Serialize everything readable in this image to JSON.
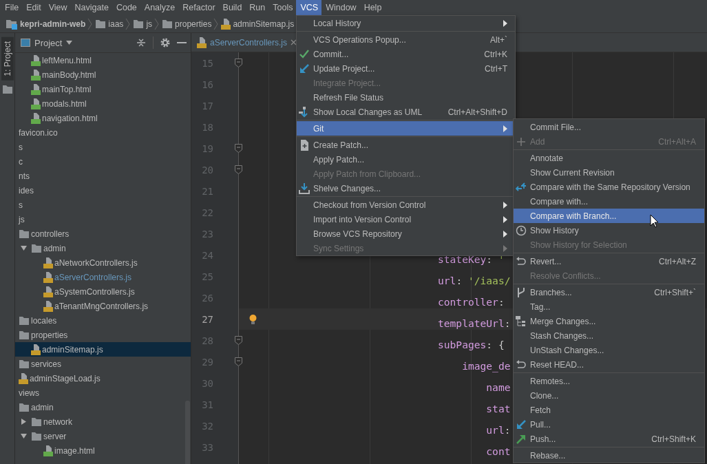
{
  "menu_bar": [
    {
      "label": "File",
      "selected": false
    },
    {
      "label": "Edit",
      "selected": false
    },
    {
      "label": "View",
      "selected": false
    },
    {
      "label": "Navigate",
      "selected": false
    },
    {
      "label": "Code",
      "selected": false
    },
    {
      "label": "Analyze",
      "selected": false
    },
    {
      "label": "Refactor",
      "selected": false
    },
    {
      "label": "Build",
      "selected": false
    },
    {
      "label": "Run",
      "selected": false
    },
    {
      "label": "Tools",
      "selected": false
    },
    {
      "label": "VCS",
      "selected": true
    },
    {
      "label": "Window",
      "selected": false
    },
    {
      "label": "Help",
      "selected": false
    }
  ],
  "breadcrumbs": [
    {
      "label": "kepri-admin-web",
      "kind": "module"
    },
    {
      "label": "iaas",
      "kind": "folder"
    },
    {
      "label": "js",
      "kind": "folder"
    },
    {
      "label": "properties",
      "kind": "folder"
    },
    {
      "label": "adminSitemap.js",
      "kind": "js"
    }
  ],
  "tool_strip": {
    "label": "1: Project",
    "selected": true
  },
  "project_panel": {
    "title": "Project",
    "tree": [
      {
        "children": [
          {
            "children": [
              {
                "label": "leftMenu.html",
                "kind": "html",
                "selected": false,
                "modified": false
              },
              {
                "label": "mainBody.html",
                "kind": "html",
                "selected": false,
                "modified": false
              },
              {
                "label": "mainTop.html",
                "kind": "html",
                "selected": false,
                "modified": false
              },
              {
                "label": "modals.html",
                "kind": "html",
                "selected": false,
                "modified": false
              },
              {
                "label": "navigation.html",
                "kind": "html",
                "selected": false,
                "modified": false
              }
            ]
          }
        ]
      },
      {
        "label": "favicon.ico",
        "kind": "text",
        "selected": false,
        "modified": false
      },
      {
        "label": "s",
        "kind": "text",
        "selected": false,
        "modified": false
      },
      {
        "label": "c",
        "kind": "text",
        "selected": false,
        "modified": false
      },
      {
        "label": "nts",
        "kind": "text",
        "selected": false,
        "modified": false
      },
      {
        "label": "ides",
        "kind": "text",
        "selected": false,
        "modified": false
      },
      {
        "label": "s",
        "kind": "text",
        "selected": false,
        "modified": false
      },
      {
        "label": "js",
        "kind": "text",
        "selected": false,
        "modified": false,
        "children": [
          {
            "label": "controllers",
            "kind": "folder",
            "selected": false,
            "modified": false,
            "children": [
              {
                "label": "admin",
                "kind": "folder",
                "selected": false,
                "modified": false,
                "expanded": true,
                "children": [
                  {
                    "label": "aNetworkControllers.js",
                    "kind": "js",
                    "selected": false,
                    "modified": false
                  },
                  {
                    "label": "aServerControllers.js",
                    "kind": "js",
                    "selected": false,
                    "modified": true
                  },
                  {
                    "label": "aSystemControllers.js",
                    "kind": "js",
                    "selected": false,
                    "modified": false
                  },
                  {
                    "label": "aTenantMngControllers.js",
                    "kind": "js",
                    "selected": false,
                    "modified": false
                  }
                ]
              }
            ]
          },
          {
            "label": "locales",
            "kind": "folder",
            "selected": false,
            "modified": false
          },
          {
            "label": "properties",
            "kind": "folder",
            "selected": false,
            "modified": false,
            "children": [
              {
                "label": "adminSitemap.js",
                "kind": "js",
                "selected": true,
                "modified": false
              }
            ]
          },
          {
            "label": "services",
            "kind": "folder",
            "selected": false,
            "modified": false
          },
          {
            "label": "adminStageLoad.js",
            "kind": "js",
            "selected": false,
            "modified": false
          }
        ]
      },
      {
        "label": "views",
        "kind": "text",
        "selected": false,
        "modified": false,
        "children": [
          {
            "label": "admin",
            "kind": "folder",
            "selected": false,
            "modified": false,
            "children": [
              {
                "label": "network",
                "kind": "folder",
                "selected": false,
                "modified": false,
                "expanded": false
              },
              {
                "label": "server",
                "kind": "folder",
                "selected": false,
                "modified": false,
                "expanded": true,
                "children": [
                  {
                    "label": "image.html",
                    "kind": "html",
                    "selected": false,
                    "modified": false
                  }
                ]
              }
            ]
          }
        ]
      }
    ]
  },
  "editor": {
    "tab": {
      "label": "aServerControllers.js",
      "selected": true
    },
    "lines": [
      {
        "number": "15",
        "fold": true,
        "current": false
      },
      {
        "number": "16",
        "fold": false,
        "current": false
      },
      {
        "number": "17",
        "fold": false,
        "current": false
      },
      {
        "number": "18",
        "fold": false,
        "current": false
      },
      {
        "number": "19",
        "fold": true,
        "current": false
      },
      {
        "number": "20",
        "fold": true,
        "current": false
      },
      {
        "number": "21",
        "fold": false,
        "current": false
      },
      {
        "number": "22",
        "fold": false,
        "current": false
      },
      {
        "number": "23",
        "fold": false,
        "current": false
      },
      {
        "number": "24",
        "fold": false,
        "current": false,
        "tokens": [
          {
            "text": "                            stateKey",
            "kind": "key"
          },
          {
            "text": ": ",
            "kind": "punct"
          },
          {
            "text": "'",
            "kind": "string"
          }
        ]
      },
      {
        "number": "25",
        "fold": false,
        "current": false,
        "tokens": [
          {
            "text": "                            url",
            "kind": "key"
          },
          {
            "text": ": ",
            "kind": "punct"
          },
          {
            "text": "'/iaas/",
            "kind": "string"
          }
        ]
      },
      {
        "number": "26",
        "fold": false,
        "current": false,
        "tokens": [
          {
            "text": "                            controller",
            "kind": "key"
          },
          {
            "text": ":",
            "kind": "punct"
          }
        ]
      },
      {
        "number": "27",
        "fold": false,
        "current": true,
        "tokens": [
          {
            "text": "                            templateUrl",
            "kind": "key"
          },
          {
            "text": ":",
            "kind": "punct"
          }
        ]
      },
      {
        "number": "28",
        "fold": true,
        "current": false,
        "tokens": [
          {
            "text": "                            subPages",
            "kind": "key"
          },
          {
            "text": ": {",
            "kind": "punct"
          }
        ]
      },
      {
        "number": "29",
        "fold": true,
        "current": false,
        "tokens": [
          {
            "text": "                                image_de",
            "kind": "key"
          }
        ]
      },
      {
        "number": "30",
        "fold": false,
        "current": false,
        "tokens": [
          {
            "text": "                                    name",
            "kind": "key"
          }
        ]
      },
      {
        "number": "31",
        "fold": false,
        "current": false,
        "tokens": [
          {
            "text": "                                    stat",
            "kind": "key"
          }
        ]
      },
      {
        "number": "32",
        "fold": false,
        "current": false,
        "tokens": [
          {
            "text": "                                    url",
            "kind": "key"
          },
          {
            "text": ":",
            "kind": "punct"
          }
        ]
      },
      {
        "number": "33",
        "fold": false,
        "current": false,
        "tokens": [
          {
            "text": "                                    cont",
            "kind": "key"
          }
        ]
      }
    ]
  },
  "vcs_menu": {
    "groups": [
      [
        {
          "label": "Local History",
          "submenu": true,
          "disabled": false,
          "selected": false
        }
      ],
      [
        {
          "label": "VCS Operations Popup...",
          "shortcut": "Alt+`",
          "submenu": false,
          "disabled": false,
          "selected": false
        },
        {
          "label": "Commit...",
          "shortcut": "Ctrl+K",
          "submenu": false,
          "disabled": false,
          "selected": false
        },
        {
          "label": "Update Project...",
          "shortcut": "Ctrl+T",
          "submenu": false,
          "disabled": false,
          "selected": false
        },
        {
          "label": "Integrate Project...",
          "submenu": false,
          "disabled": true,
          "selected": false
        },
        {
          "label": "Refresh File Status",
          "submenu": false,
          "disabled": false,
          "selected": false
        },
        {
          "label": "Show Local Changes as UML",
          "shortcut": "Ctrl+Alt+Shift+D",
          "submenu": false,
          "disabled": false,
          "selected": false
        }
      ],
      [
        {
          "label": "Git",
          "submenu": true,
          "disabled": false,
          "selected": true
        }
      ],
      [
        {
          "label": "Create Patch...",
          "submenu": false,
          "disabled": false,
          "selected": false
        },
        {
          "label": "Apply Patch...",
          "submenu": false,
          "disabled": false,
          "selected": false
        },
        {
          "label": "Apply Patch from Clipboard...",
          "submenu": false,
          "disabled": true,
          "selected": false
        },
        {
          "label": "Shelve Changes...",
          "submenu": false,
          "disabled": false,
          "selected": false
        }
      ],
      [
        {
          "label": "Checkout from Version Control",
          "submenu": true,
          "disabled": false,
          "selected": false
        },
        {
          "label": "Import into Version Control",
          "submenu": true,
          "disabled": false,
          "selected": false
        },
        {
          "label": "Browse VCS Repository",
          "submenu": true,
          "disabled": false,
          "selected": false
        },
        {
          "label": "Sync Settings",
          "submenu": true,
          "disabled": true,
          "selected": false
        }
      ]
    ]
  },
  "git_submenu": {
    "groups": [
      [
        {
          "label": "Commit File...",
          "submenu": false,
          "disabled": false,
          "selected": false
        },
        {
          "label": "Add",
          "shortcut": "Ctrl+Alt+A",
          "submenu": false,
          "disabled": true,
          "selected": false
        }
      ],
      [
        {
          "label": "Annotate",
          "submenu": false,
          "disabled": false,
          "selected": false
        },
        {
          "label": "Show Current Revision",
          "submenu": false,
          "disabled": false,
          "selected": false
        },
        {
          "label": "Compare with the Same Repository Version",
          "submenu": false,
          "disabled": false,
          "selected": false
        },
        {
          "label": "Compare with...",
          "submenu": false,
          "disabled": false,
          "selected": false
        },
        {
          "label": "Compare with Branch...",
          "submenu": false,
          "disabled": false,
          "selected": true
        },
        {
          "label": "Show History",
          "submenu": false,
          "disabled": false,
          "selected": false
        },
        {
          "label": "Show History for Selection",
          "submenu": false,
          "disabled": true,
          "selected": false
        }
      ],
      [
        {
          "label": "Revert...",
          "shortcut": "Ctrl+Alt+Z",
          "submenu": false,
          "disabled": false,
          "selected": false
        },
        {
          "label": "Resolve Conflicts...",
          "submenu": false,
          "disabled": true,
          "selected": false
        }
      ],
      [
        {
          "label": "Branches...",
          "shortcut": "Ctrl+Shift+`",
          "submenu": false,
          "disabled": false,
          "selected": false
        },
        {
          "label": "Tag...",
          "submenu": false,
          "disabled": false,
          "selected": false
        },
        {
          "label": "Merge Changes...",
          "submenu": false,
          "disabled": false,
          "selected": false
        },
        {
          "label": "Stash Changes...",
          "submenu": false,
          "disabled": false,
          "selected": false
        },
        {
          "label": "UnStash Changes...",
          "submenu": false,
          "disabled": false,
          "selected": false
        },
        {
          "label": "Reset HEAD...",
          "submenu": false,
          "disabled": false,
          "selected": false
        }
      ],
      [
        {
          "label": "Remotes...",
          "submenu": false,
          "disabled": false,
          "selected": false
        },
        {
          "label": "Clone...",
          "submenu": false,
          "disabled": false,
          "selected": false
        },
        {
          "label": "Fetch",
          "submenu": false,
          "disabled": false,
          "selected": false
        },
        {
          "label": "Pull...",
          "submenu": false,
          "disabled": false,
          "selected": false
        },
        {
          "label": "Push...",
          "shortcut": "Ctrl+Shift+K",
          "submenu": false,
          "disabled": false,
          "selected": false
        }
      ],
      [
        {
          "label": "Rebase...",
          "submenu": false,
          "disabled": false,
          "selected": false
        }
      ]
    ]
  }
}
